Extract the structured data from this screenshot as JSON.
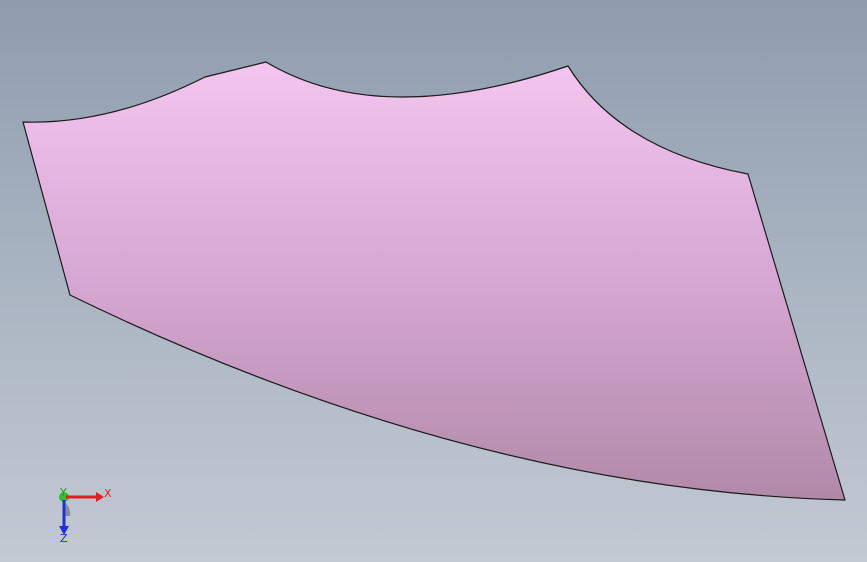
{
  "viewport": {
    "background_top": "#8e9cae",
    "background_bottom": "#c3c9d3"
  },
  "part": {
    "face_color_top": "#f3c5ef",
    "face_color_bottom": "#b48aaa",
    "edge_color": "#1a1a1a"
  },
  "triad": {
    "x_label": "X",
    "y_label": "Y",
    "z_label": "Z",
    "x_color": "#e02020",
    "y_color": "#20c020",
    "z_color": "#2030e0"
  }
}
